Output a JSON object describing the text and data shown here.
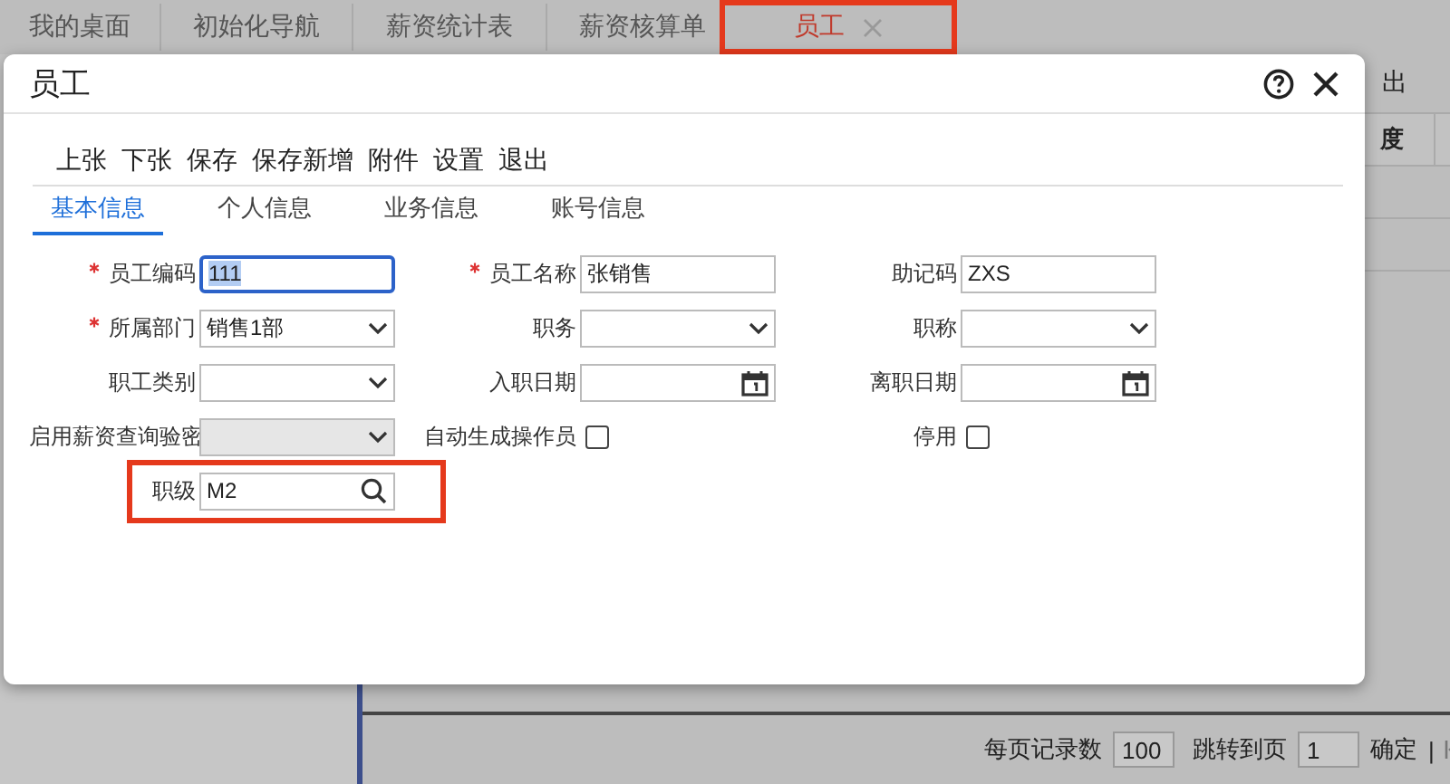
{
  "tabs": [
    {
      "label": "我的桌面",
      "selected": false,
      "closable": false,
      "highlighted": false
    },
    {
      "label": "初始化导航",
      "selected": false,
      "closable": false,
      "highlighted": false
    },
    {
      "label": "薪资统计表",
      "selected": false,
      "closable": false,
      "highlighted": false
    },
    {
      "label": "薪资核算单",
      "selected": false,
      "closable": false,
      "highlighted": false
    },
    {
      "label": "员工",
      "selected": true,
      "closable": true,
      "highlighted": true
    }
  ],
  "background": {
    "toolbar_text": "出",
    "table_header": "度",
    "page_size_label": "每页记录数",
    "page_size": "100",
    "goto_label": "跳转到页",
    "goto_page": "1",
    "confirm": "确定",
    "separator": "|"
  },
  "dialog": {
    "title": "员工",
    "toolbar": [
      "上张",
      "下张",
      "保存",
      "保存新增",
      "附件",
      "设置",
      "退出"
    ],
    "tabs": [
      {
        "label": "基本信息",
        "selected": true
      },
      {
        "label": "个人信息",
        "selected": false
      },
      {
        "label": "业务信息",
        "selected": false
      },
      {
        "label": "账号信息",
        "selected": false
      }
    ],
    "fields": [
      {
        "label": "员工编码",
        "kind": "text",
        "value": "111",
        "required": true,
        "focused": true,
        "highlighted": false
      },
      {
        "label": "员工名称",
        "kind": "text",
        "value": "张销售",
        "required": true,
        "focused": false,
        "highlighted": false
      },
      {
        "label": "助记码",
        "kind": "text",
        "value": "ZXS",
        "required": false,
        "focused": false,
        "highlighted": false
      },
      {
        "label": "所属部门",
        "kind": "select",
        "value": "销售1部",
        "required": true,
        "disabled": false,
        "highlighted": false
      },
      {
        "label": "职务",
        "kind": "select",
        "required": false,
        "disabled": false,
        "highlighted": false
      },
      {
        "label": "职称",
        "kind": "select",
        "required": false,
        "disabled": false,
        "highlighted": false
      },
      {
        "label": "职工类别",
        "kind": "select",
        "required": false,
        "disabled": false,
        "highlighted": false
      },
      {
        "label": "入职日期",
        "kind": "date",
        "required": false,
        "highlighted": false
      },
      {
        "label": "离职日期",
        "kind": "date",
        "required": false,
        "highlighted": false
      },
      {
        "label": "启用薪资查询验密",
        "kind": "select",
        "required": false,
        "disabled": true,
        "highlighted": false
      },
      {
        "label": "自动生成操作员",
        "kind": "checkbox",
        "checked": false,
        "required": false,
        "highlighted": false
      },
      {
        "label": "停用",
        "kind": "checkbox",
        "checked": false,
        "required": false,
        "highlighted": false
      },
      {
        "label": "职级",
        "kind": "lookup",
        "value": "M2",
        "required": false,
        "highlighted": true
      }
    ]
  }
}
